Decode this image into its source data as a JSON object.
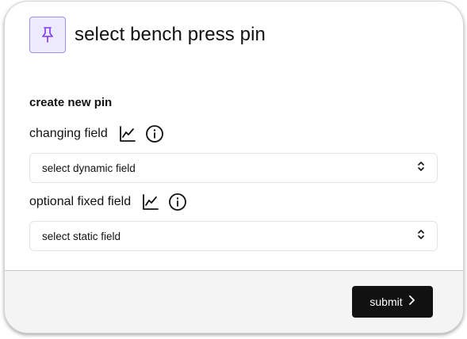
{
  "header": {
    "title": "select bench press pin",
    "pin_icon": "pushpin-icon"
  },
  "form": {
    "section_title": "create new pin",
    "changing_field": {
      "label": "changing field",
      "chart_icon": "line-chart-icon",
      "info_icon": "info-icon",
      "select_value": "select dynamic field"
    },
    "fixed_field": {
      "label": "optional fixed field",
      "chart_icon": "line-chart-icon",
      "info_icon": "info-icon",
      "select_value": "select static field"
    }
  },
  "footer": {
    "submit_label": "submit",
    "submit_icon": "chevron-right-icon"
  },
  "colors": {
    "accent_purple": "#7c3aed",
    "pin_bg": "#ede9fe",
    "button_bg": "#111111",
    "footer_bg": "#f4f4f5"
  }
}
